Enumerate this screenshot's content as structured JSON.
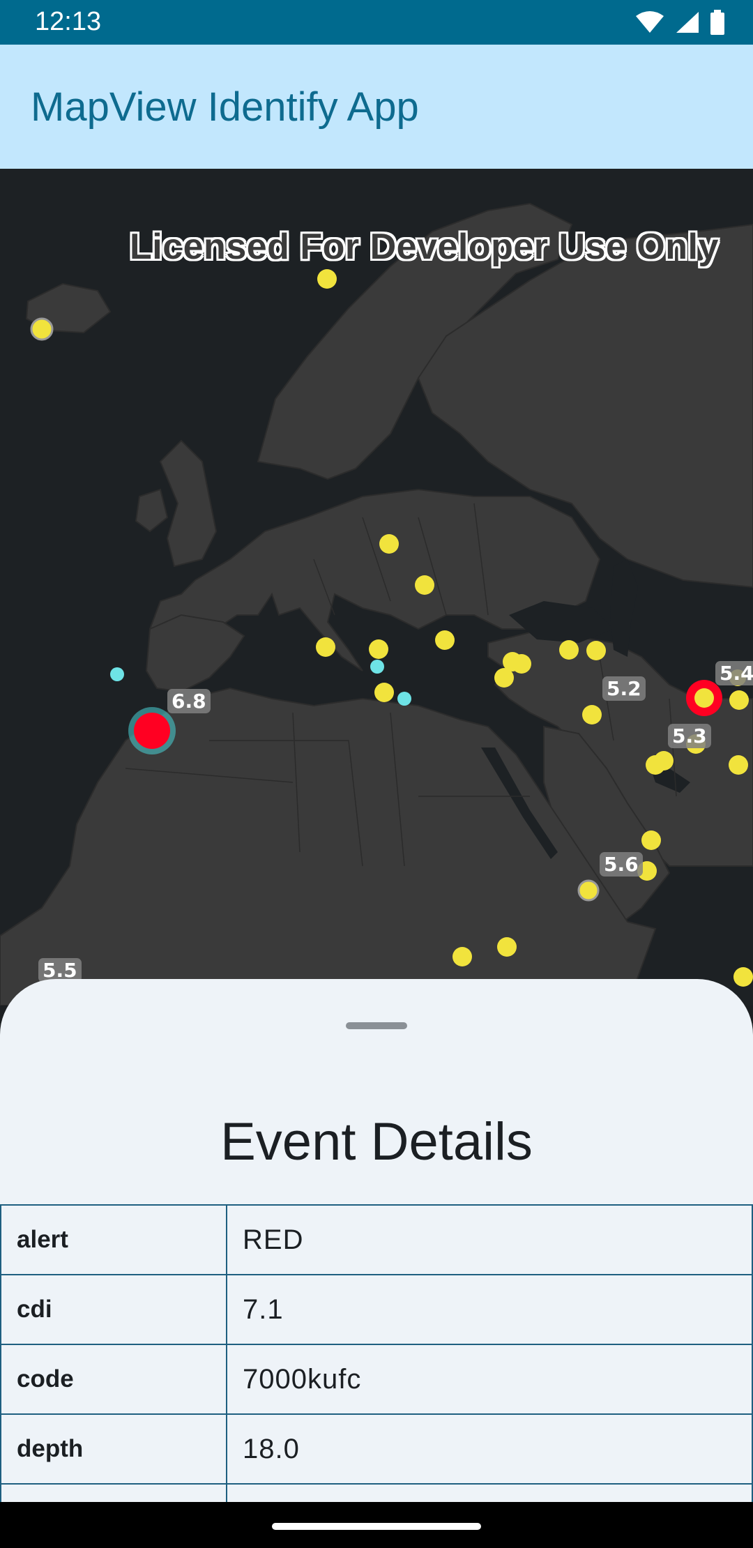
{
  "status_bar": {
    "time": "12:13"
  },
  "app_bar": {
    "title": "MapView Identify App"
  },
  "map": {
    "watermark": "Licensed For Developer Use Only",
    "magnitude_labels": [
      "6.8",
      "5.2",
      "5.4",
      "5.3",
      "5.6",
      "5.5"
    ]
  },
  "sheet": {
    "title": "Event Details",
    "rows": [
      {
        "key": "alert",
        "value": "RED"
      },
      {
        "key": "cdi",
        "value": "7.1"
      },
      {
        "key": "code",
        "value": "7000kufc"
      },
      {
        "key": "depth",
        "value": "18.0"
      }
    ]
  },
  "colors": {
    "status_bar": "#006a8e",
    "app_bar": "#c2e7fd",
    "title": "#0e6b8f",
    "map_water": "#1d2124",
    "map_land": "#3a3a3a",
    "quake_yellow": "#f1e33d",
    "quake_red": "#ff0022",
    "quake_cyan": "#6ee3e6",
    "sheet_bg": "#eef3f8",
    "table_border": "#1e5f80"
  }
}
